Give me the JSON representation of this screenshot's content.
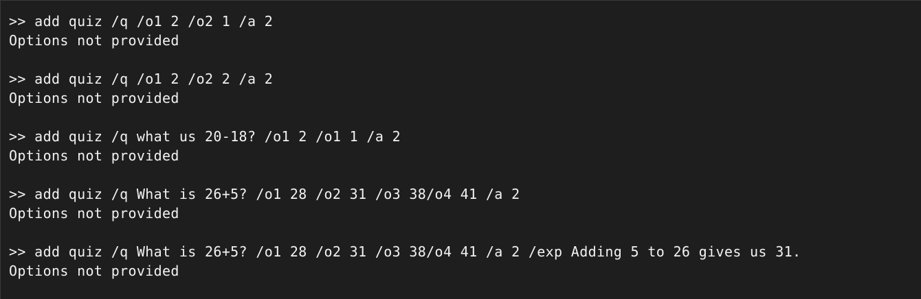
{
  "terminal": {
    "entries": [
      {
        "command": ">> add quiz /q /o1 2 /o2 1 /a 2",
        "output": "Options not provided"
      },
      {
        "command": ">> add quiz /q /o1 2 /o2 2 /a 2",
        "output": "Options not provided"
      },
      {
        "command": ">> add quiz /q what us 20-18? /o1 2 /o1 1 /a 2",
        "output": "Options not provided"
      },
      {
        "command": ">> add quiz /q What is 26+5? /o1 28 /o2 31 /o3 38/o4 41 /a 2",
        "output": "Options not provided"
      },
      {
        "command": ">> add quiz /q What is 26+5? /o1 28 /o2 31 /o3 38/o4 41 /a 2 /exp Adding 5 to 26 gives us 31.",
        "output": "Options not provided"
      }
    ]
  }
}
